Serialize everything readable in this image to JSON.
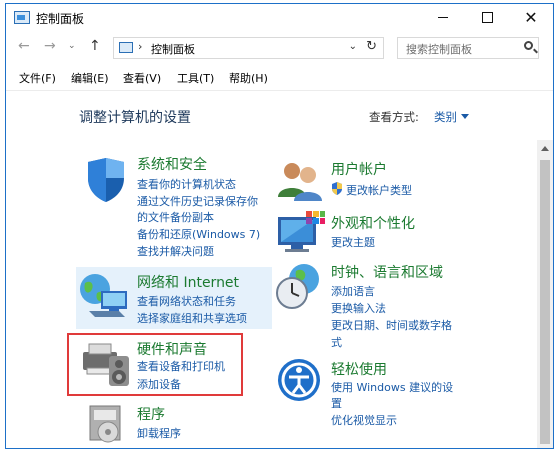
{
  "window": {
    "title": "控制面板"
  },
  "nav": {
    "back": "←",
    "forward": "→",
    "recent": "⌄",
    "up": "↑",
    "address_separator": "›",
    "address": "控制面板",
    "address_dropdown": "⌄",
    "refresh": "↻",
    "search_placeholder": "搜索控制面板"
  },
  "menu": [
    {
      "label": "文件(F)"
    },
    {
      "label": "编辑(E)"
    },
    {
      "label": "查看(V)"
    },
    {
      "label": "工具(T)"
    },
    {
      "label": "帮助(H)"
    }
  ],
  "content": {
    "heading": "调整计算机的设置",
    "view_by_label": "查看方式:",
    "view_by_value": "类别"
  },
  "categories": {
    "system": {
      "title": "系统和安全",
      "links": [
        "查看你的计算机状态",
        "通过文件历史记录保存你",
        "的文件备份副本",
        "备份和还原(Windows 7)",
        "查找并解决问题"
      ]
    },
    "network": {
      "title": "网络和 Internet",
      "links": [
        "查看网络状态和任务",
        "选择家庭组和共享选项"
      ]
    },
    "hardware": {
      "title": "硬件和声音",
      "links": [
        "查看设备和打印机",
        "添加设备"
      ]
    },
    "programs": {
      "title": "程序",
      "links": [
        "卸载程序"
      ]
    },
    "users": {
      "title": "用户帐户",
      "links": [
        "更改帐户类型"
      ]
    },
    "appearance": {
      "title": "外观和个性化",
      "links": [
        "更改主题"
      ]
    },
    "clock": {
      "title": "时钟、语言和区域",
      "links": [
        "添加语言",
        "更换输入法",
        "更改日期、时间或数字格",
        "式"
      ]
    },
    "ease": {
      "title": "轻松使用",
      "links": [
        "使用 Windows 建议的设",
        "置",
        "优化视觉显示"
      ]
    }
  },
  "colors": {
    "category_title": "#1b7a30",
    "link": "#1a5aa6",
    "highlight_box": "#e03a3a",
    "hover": "#e5f1fb"
  }
}
